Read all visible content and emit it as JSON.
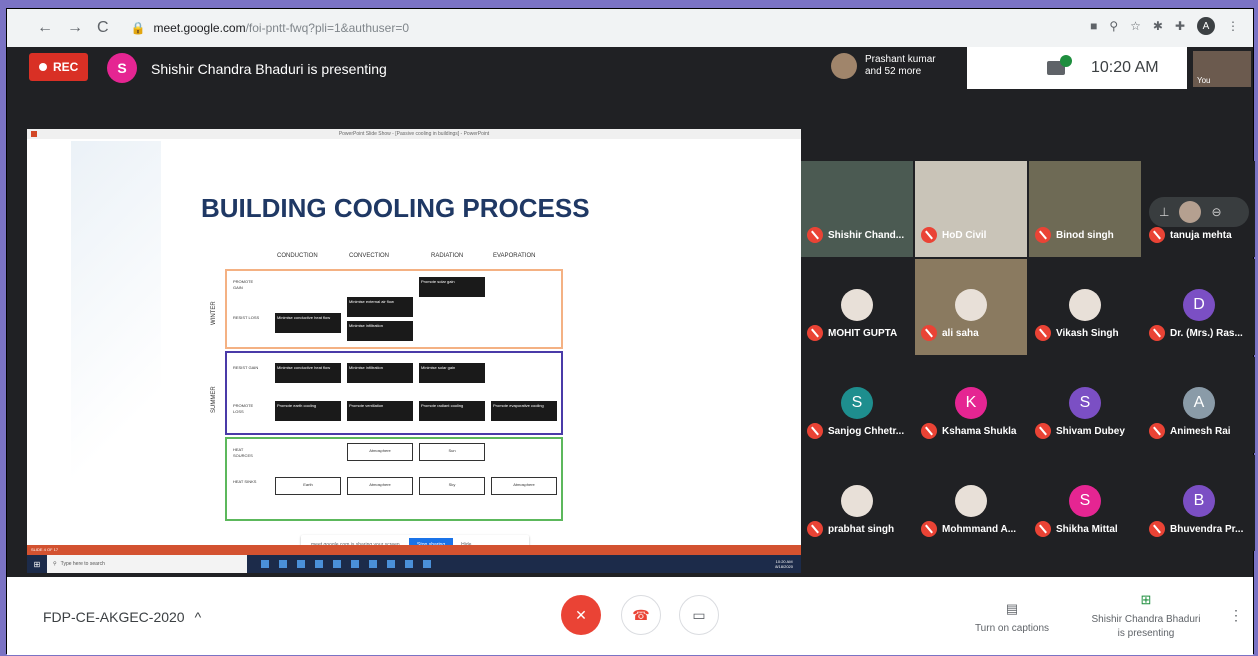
{
  "browser": {
    "back": "←",
    "forward": "→",
    "reload": "C",
    "lock": "🔒",
    "url_host": "meet.google.com",
    "url_path": "/foi-pntt-fwq?pli=1&authuser=0",
    "profile_initial": "A"
  },
  "topbar": {
    "rec_label": "REC",
    "presenter_initial": "S",
    "presenting_text": "Shishir Chandra Bhaduri is presenting",
    "participants_line1": "Prashant kumar",
    "participants_line2": "and 52 more",
    "time": "10:20 AM",
    "self_label": "You"
  },
  "slide": {
    "window_title": "PowerPoint Slide Show - [Passive cooling in buildings] - PowerPoint",
    "title": "BUILDING COOLING PROCESS",
    "columns": [
      "CONDUCTION",
      "CONVECTION",
      "RADIATION",
      "EVAPORATION"
    ],
    "winter_label": "WINTER",
    "summer_label": "SUMMER",
    "rows": {
      "promote_gain": "PROMOTE GAIN",
      "resist_loss": "RESIST LOSS",
      "resist_gain": "RESIST GAIN",
      "promote_loss": "PROMOTE LOSS",
      "heat_sources": "HEAT SOURCES",
      "heat_sinks": "HEAT SINKS"
    },
    "boxes": {
      "promote_solar_gain": "Promote solar gain",
      "minimise_external_air_flow": "Minimise external air flow",
      "minimise_infiltration": "Minimise infiltration",
      "minimise_conductive_heat_flow": "Minimise conductive heat flow",
      "minimise_conductive_heat_flow_summer": "Minimise conductive heat flow",
      "minimise_infiltration_summer": "Minimise infiltration",
      "minimise_solar_gain": "Minimise solar gain",
      "promote_earth_cooling": "Promote earth cooling",
      "promote_ventilation": "Promote ventilation",
      "promote_radiant_cooling": "Promote radiant cooling",
      "promote_evaporative_cooling": "Promote evaporative cooling",
      "src_atmosphere": "Atmosphere",
      "src_sun": "Sun",
      "sink_earth": "Earth",
      "sink_atmosphere": "Atmosphere",
      "sink_sky": "Sky",
      "sink_atmosphere2": "Atmosphere"
    },
    "share_text": "meet.google.com is sharing your screen.",
    "stop_sharing": "Stop sharing",
    "hide": "Hide",
    "status": "SLIDE 4 OF 17"
  },
  "taskbar": {
    "search_placeholder": "Type here to search",
    "clock_time": "10:20 AM",
    "clock_date": "8/18/2020"
  },
  "participants": [
    {
      "name": "Shishir Chand..."
    },
    {
      "name": "HoD Civil"
    },
    {
      "name": "Binod singh"
    },
    {
      "name": "tanuja mehta"
    },
    {
      "name": "MOHIT GUPTA"
    },
    {
      "name": "ali saha"
    },
    {
      "name": "Vikash Singh"
    },
    {
      "name": "Dr. (Mrs.) Ras...",
      "initial": "D"
    },
    {
      "name": "Sanjog Chhetr...",
      "initial": "S"
    },
    {
      "name": "Kshama Shukla",
      "initial": "K"
    },
    {
      "name": "Shivam Dubey",
      "initial": "S"
    },
    {
      "name": "Animesh Rai",
      "initial": "A"
    },
    {
      "name": "prabhat singh"
    },
    {
      "name": "Mohmmand A..."
    },
    {
      "name": "Shikha Mittal",
      "initial": "S"
    },
    {
      "name": "Bhuvendra Pr...",
      "initial": "B"
    }
  ],
  "colors": {
    "rec": "#d93025",
    "mic_off": "#ea4335",
    "pink": "#e52592",
    "purple": "#7b4fc4",
    "gray": "#8a9ba8",
    "winter": "#f4b183",
    "summer": "#4a3aa8",
    "heat": "#5cb85c"
  },
  "bottom": {
    "meeting_code": "FDP-CE-AKGEC-2020",
    "caret": "^",
    "captions": "Turn on captions",
    "presenting_line1": "Shishir Chandra Bhaduri",
    "presenting_line2": "is presenting",
    "more": "⋮"
  }
}
